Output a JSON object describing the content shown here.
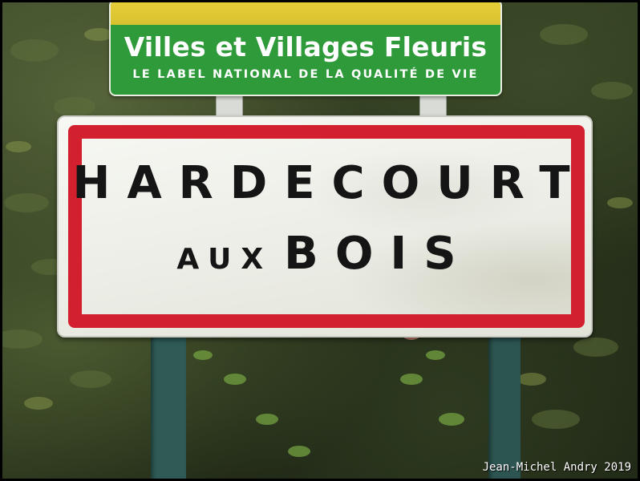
{
  "label_sign": {
    "title": "Villes et Villages Fleuris",
    "subtitle": "LE LABEL NATIONAL DE LA QUALITÉ DE VIE",
    "colors": {
      "green": "#2e9a3a",
      "yellow": "#e7cf3a",
      "text": "#ffffff"
    }
  },
  "town_sign": {
    "line1": "HARDECOURT",
    "line2_small": "AUX",
    "line2_big": "BOIS",
    "colors": {
      "border": "#d3202e",
      "background": "#f4f5f0",
      "text": "#151515"
    }
  },
  "credit": "Jean-Michel Andry 2019"
}
